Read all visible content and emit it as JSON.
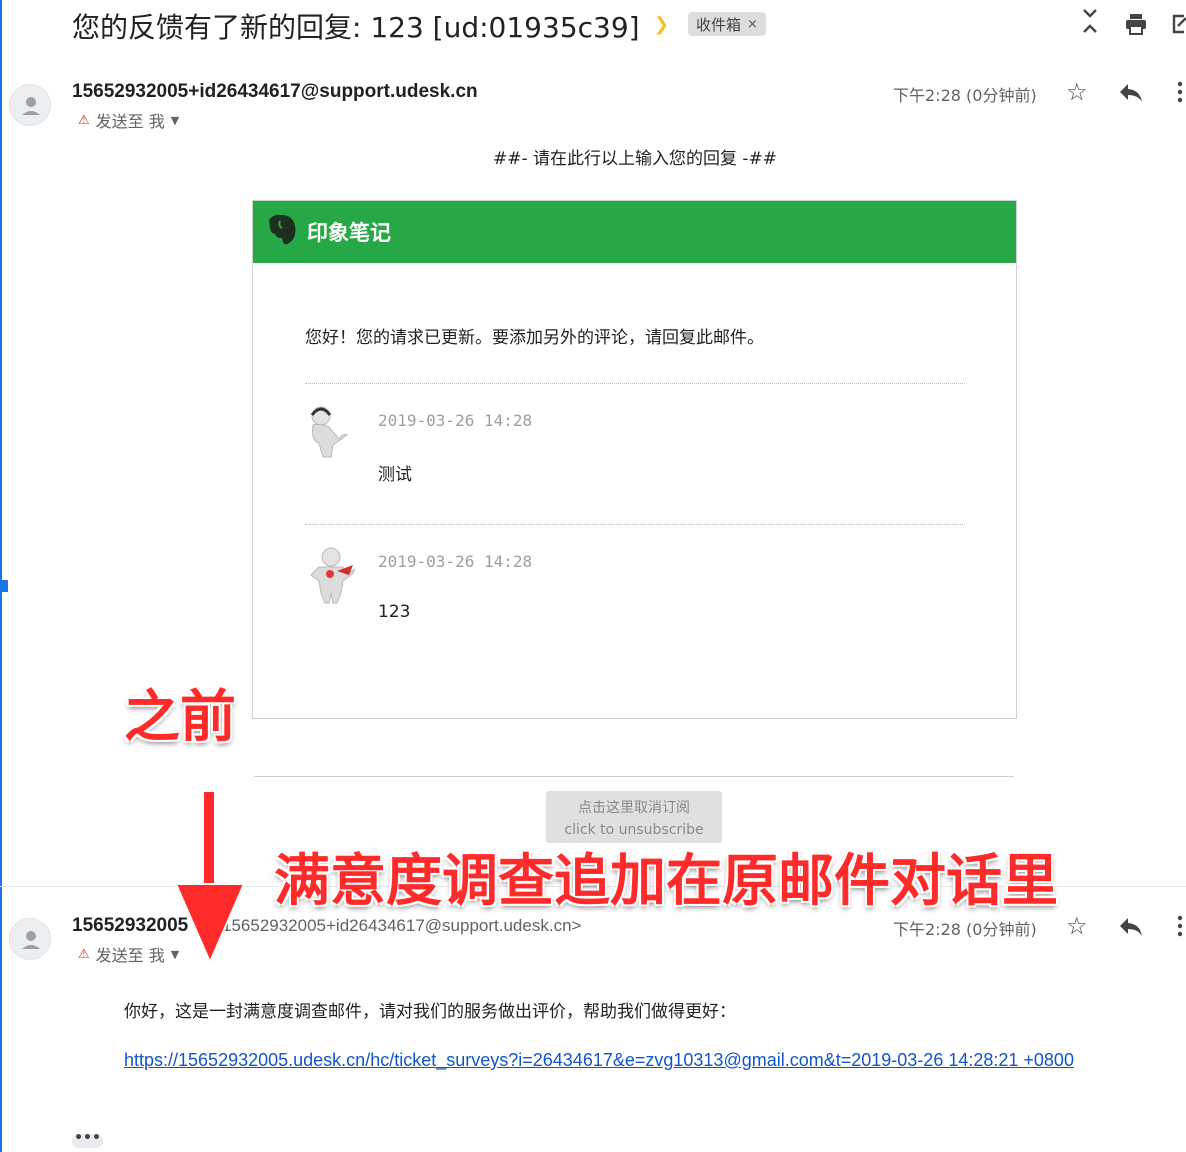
{
  "header": {
    "subject": "您的反馈有了新的回复: 123 [ud:01935c39]",
    "label_chip": "收件箱",
    "label_chip_close": "×",
    "icons": [
      "collapse-expand-icon",
      "print-icon",
      "open-new-window-icon"
    ]
  },
  "messages": [
    {
      "sender": "15652932005+id26434617@support.udesk.cn",
      "sender_addr": "",
      "to_line": "发送至 我",
      "time": "下午2:28 (0分钟前)",
      "reply_marker": "##- 请在此行以上输入您的回复 -##",
      "card": {
        "brand": "印象笔记",
        "brand_color": "#25a845",
        "intro": "您好！您的请求已更新。要添加另外的评论，请回复此邮件。",
        "comments": [
          {
            "date": "2019-03-26 14:28",
            "text": "测试",
            "avatar": "agent-headset-avatar"
          },
          {
            "date": "2019-03-26 14:28",
            "text": "123",
            "avatar": "customer-avatar"
          }
        ]
      },
      "unsubscribe": {
        "line1": "点击这里取消订阅",
        "line2": "click to unsubscribe"
      }
    },
    {
      "sender": "15652932005",
      "sender_addr": "15652932005+id26434617@support.udesk.cn>",
      "to_line": "发送至 我",
      "time": "下午2:28 (0分钟前)",
      "body": "你好，这是一封满意度调查邮件，请对我们的服务做出评价，帮助我们做得更好：",
      "link": "https://15652932005.udesk.cn/hc/ticket_surveys?i=26434617&e=zvg10313@gmail.com&t=2019-03-26 14:28:21 +0800",
      "more": "•••"
    }
  ],
  "annotations": {
    "before": "之前",
    "main": "满意度调查追加在原邮件对话里",
    "color": "#ff2a2a"
  }
}
